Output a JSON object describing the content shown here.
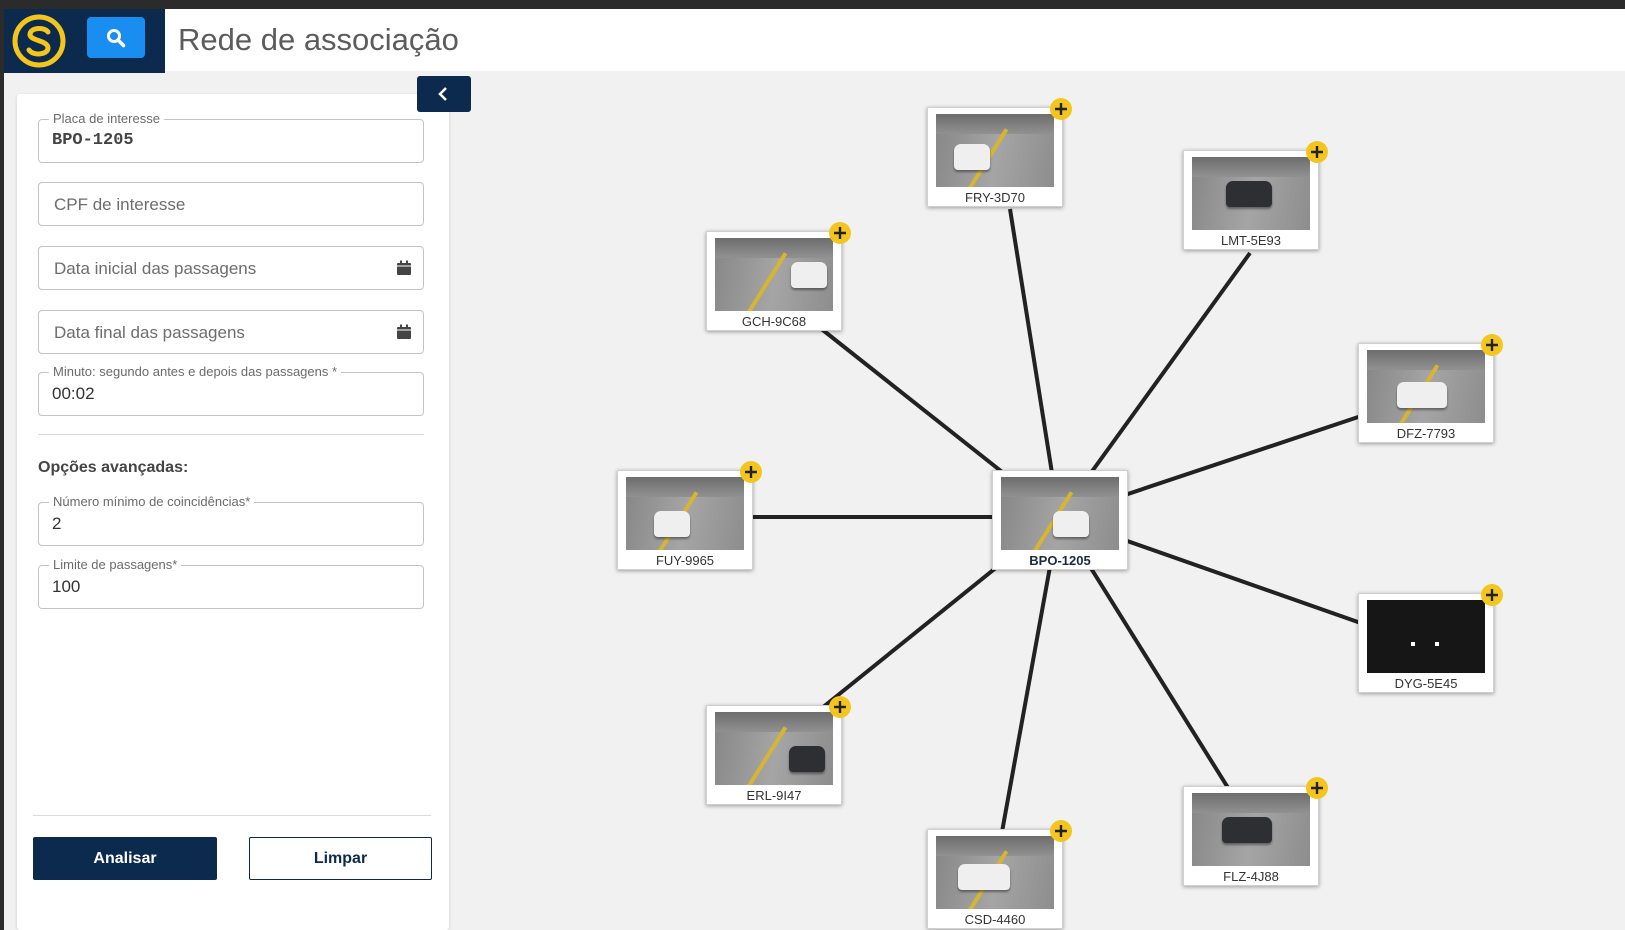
{
  "header": {
    "title": "Rede de associação",
    "logo_icon": "logo-s-icon",
    "search_icon": "search-icon"
  },
  "panel": {
    "collapse_icon": "chevron-left-icon",
    "plate_field": {
      "label": "Placa de interesse",
      "value": "BPO-1205"
    },
    "cpf_field": {
      "placeholder": "CPF de interesse"
    },
    "start_date_field": {
      "placeholder": "Data inicial das passagens",
      "icon": "calendar-icon"
    },
    "end_date_field": {
      "placeholder": "Data final das passagens",
      "icon": "calendar-icon"
    },
    "minute_field": {
      "label": "Minuto: segundo antes e depois das passagens *",
      "value": "00:02"
    },
    "advanced_title": "Opções avançadas:",
    "min_matches_field": {
      "label": "Número mínimo de coincidências*",
      "value": "2"
    },
    "limit_field": {
      "label": "Limite de passagens*",
      "value": "100"
    },
    "analyze_label": "Analisar",
    "clear_label": "Limpar"
  },
  "graph": {
    "center": {
      "plate": "BPO-1205"
    },
    "nodes": [
      {
        "plate": "FRY-3D70"
      },
      {
        "plate": "LMT-5E93"
      },
      {
        "plate": "GCH-9C68"
      },
      {
        "plate": "DFZ-7793"
      },
      {
        "plate": "FUY-9965"
      },
      {
        "plate": "DYG-5E45"
      },
      {
        "plate": "ERL-9I47"
      },
      {
        "plate": "FLZ-4J88"
      },
      {
        "plate": "CSD-4460"
      }
    ],
    "add_icon": "plus-icon",
    "colors": {
      "accent": "#f4c51d",
      "navy": "#0c2a4d",
      "edge": "#222222"
    }
  }
}
